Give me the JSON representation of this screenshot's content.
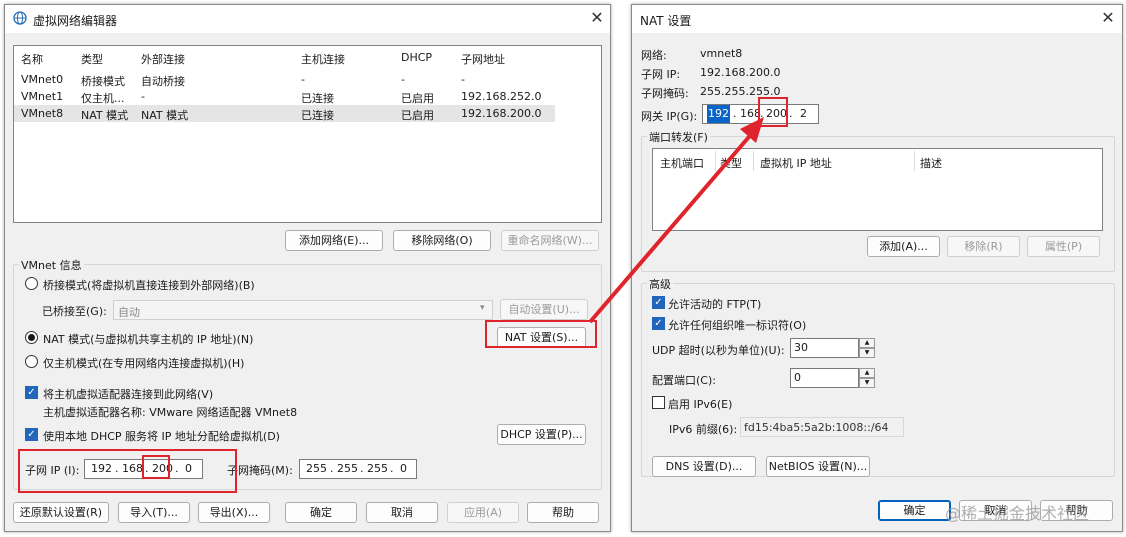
{
  "left": {
    "title": "虚拟网络编辑器",
    "headers": [
      "名称",
      "类型",
      "外部连接",
      "主机连接",
      "DHCP",
      "子网地址"
    ],
    "rows": [
      [
        "VMnet0",
        "桥接模式",
        "自动桥接",
        "-",
        "-",
        "-"
      ],
      [
        "VMnet1",
        "仅主机...",
        "-",
        "已连接",
        "已启用",
        "192.168.252.0"
      ],
      [
        "VMnet8",
        "NAT 模式",
        "NAT 模式",
        "已连接",
        "已启用",
        "192.168.200.0"
      ]
    ],
    "add_net": "添加网络(E)...",
    "remove_net": "移除网络(O)",
    "rename_net": "重命名网络(W)...",
    "vmnet_info": "VMnet 信息",
    "bridge_mode": "桥接模式(将虚拟机直接连接到外部网络)(B)",
    "bridged_to_label": "已桥接至(G):",
    "bridged_to_value": "自动",
    "auto_settings": "自动设置(U)...",
    "nat_mode": "NAT 模式(与虚拟机共享主机的 IP 地址)(N)",
    "nat_settings": "NAT 设置(S)...",
    "host_only": "仅主机模式(在专用网络内连接虚拟机)(H)",
    "connect_adapter": "将主机虚拟适配器连接到此网络(V)",
    "adapter_name": "主机虚拟适配器名称: VMware 网络适配器 VMnet8",
    "use_dhcp": "使用本地 DHCP 服务将 IP 地址分配给虚拟机(D)",
    "dhcp_settings": "DHCP 设置(P)...",
    "subnet_ip_label": "子网 IP (I):",
    "subnet_ip": [
      "192",
      "168",
      "200",
      "0"
    ],
    "subnet_mask_label": "子网掩码(M):",
    "subnet_mask": [
      "255",
      "255",
      "255",
      "0"
    ],
    "restore_defaults": "还原默认设置(R)",
    "import": "导入(T)...",
    "export": "导出(X)...",
    "ok": "确定",
    "cancel": "取消",
    "apply": "应用(A)",
    "help": "帮助"
  },
  "right": {
    "title": "NAT 设置",
    "network_label": "网络:",
    "network_value": "vmnet8",
    "subnet_ip_label": "子网 IP:",
    "subnet_ip_value": "192.168.200.0",
    "subnet_mask_label": "子网掩码:",
    "subnet_mask_value": "255.255.255.0",
    "gateway_label": "网关 IP(G):",
    "gateway": [
      "192",
      "168",
      "200",
      "2"
    ],
    "port_forwarding": "端口转发(F)",
    "pf_headers": [
      "主机端口",
      "类型",
      "虚拟机 IP 地址",
      "描述"
    ],
    "add": "添加(A)...",
    "remove": "移除(R)",
    "properties": "属性(P)",
    "advanced": "高级",
    "allow_ftp": "允许活动的 FTP(T)",
    "allow_oui": "允许任何组织唯一标识符(O)",
    "udp_timeout_label": "UDP 超时(以秒为单位)(U):",
    "udp_timeout_value": "30",
    "config_port_label": "配置端口(C):",
    "config_port_value": "0",
    "enable_ipv6": "启用 IPv6(E)",
    "ipv6_prefix_label": "IPv6 前缀(6):",
    "ipv6_prefix_value": "fd15:4ba5:5a2b:1008::/64",
    "dns_settings": "DNS 设置(D)...",
    "netbios_settings": "NetBIOS 设置(N)...",
    "ok": "确定",
    "cancel": "取消",
    "help": "帮助"
  },
  "watermark": "@稀土掘金技术社区",
  "colors": {
    "annotation_red": "#e0242b",
    "selection_blue": "#0a64c8"
  }
}
